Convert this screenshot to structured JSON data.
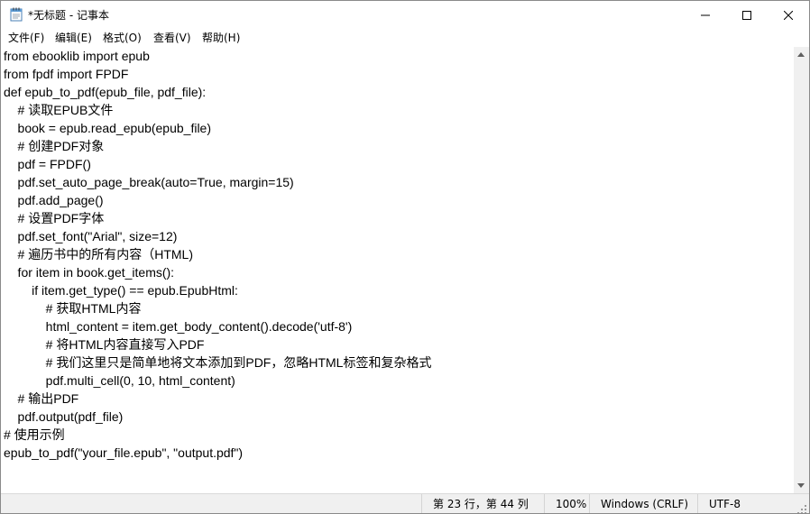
{
  "window": {
    "title": "*无标题 - 记事本",
    "minimize_icon": "minimize-icon",
    "maximize_icon": "maximize-icon",
    "close_icon": "close-icon"
  },
  "menu": {
    "items": [
      "文件(F)",
      "编辑(E)",
      "格式(O)",
      "查看(V)",
      "帮助(H)"
    ]
  },
  "editor": {
    "lines": [
      "from ebooklib import epub",
      "from fpdf import FPDF",
      "def epub_to_pdf(epub_file, pdf_file):",
      "    # 读取EPUB文件",
      "    book = epub.read_epub(epub_file)",
      "    # 创建PDF对象",
      "    pdf = FPDF()",
      "    pdf.set_auto_page_break(auto=True, margin=15)",
      "    pdf.add_page()",
      "    # 设置PDF字体",
      "    pdf.set_font(\"Arial\", size=12)",
      "    # 遍历书中的所有内容（HTML)",
      "    for item in book.get_items():",
      "        if item.get_type() == epub.EpubHtml:",
      "            # 获取HTML内容",
      "            html_content = item.get_body_content().decode('utf-8')",
      "            # 将HTML内容直接写入PDF",
      "            # 我们这里只是简单地将文本添加到PDF，忽略HTML标签和复杂格式",
      "            pdf.multi_cell(0, 10, html_content)",
      "    # 输出PDF",
      "    pdf.output(pdf_file)",
      "# 使用示例",
      "epub_to_pdf(\"your_file.epub\", \"output.pdf\")"
    ]
  },
  "status": {
    "position": "第 23 行，第 44 列",
    "zoom": "100%",
    "line_ending": "Windows (CRLF)",
    "encoding": "UTF-8"
  },
  "colors": {
    "statusbar_bg": "#f0f0f0",
    "scrollbar_bg": "#f0f0f0",
    "text": "#000000"
  }
}
